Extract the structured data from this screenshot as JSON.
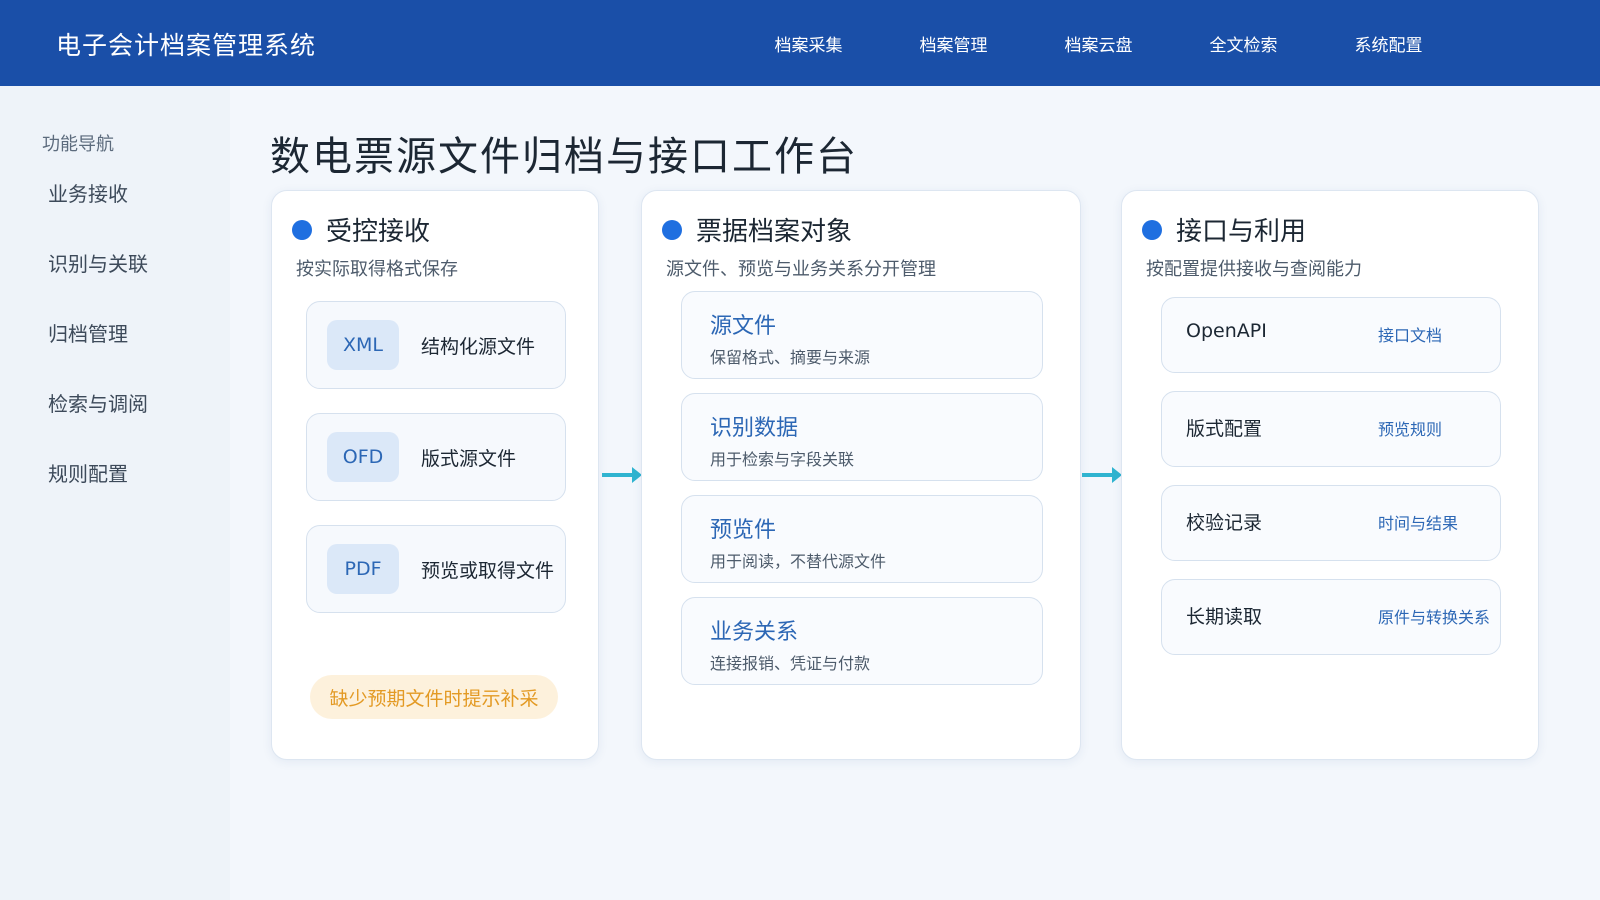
{
  "header": {
    "app_title": "电子会计档案管理系统",
    "nav": [
      "档案采集",
      "档案管理",
      "档案云盘",
      "全文检索",
      "系统配置"
    ]
  },
  "sidebar": {
    "title": "功能导航",
    "items": [
      "业务接收",
      "识别与关联",
      "归档管理",
      "检索与调阅",
      "规则配置"
    ]
  },
  "main": {
    "page_title": "数电票源文件归档与接口工作台",
    "intake": {
      "title": "受控接收",
      "subtitle": "按实际取得格式保存",
      "formats": [
        {
          "badge": "XML",
          "label": "结构化源文件"
        },
        {
          "badge": "OFD",
          "label": "版式源文件"
        },
        {
          "badge": "PDF",
          "label": "预览或取得文件"
        }
      ],
      "warning": "缺少预期文件时提示补采"
    },
    "objects": {
      "title": "票据档案对象",
      "subtitle": "源文件、预览与业务关系分开管理",
      "items": [
        {
          "title": "源文件",
          "desc": "保留格式、摘要与来源"
        },
        {
          "title": "识别数据",
          "desc": "用于检索与字段关联"
        },
        {
          "title": "预览件",
          "desc": "用于阅读，不替代源文件"
        },
        {
          "title": "业务关系",
          "desc": "连接报销、凭证与付款"
        }
      ]
    },
    "api": {
      "title": "接口与利用",
      "subtitle": "按配置提供接收与查阅能力",
      "items": [
        {
          "name": "OpenAPI",
          "link": "接口文档"
        },
        {
          "name": "版式配置",
          "link": "预览规则"
        },
        {
          "name": "校验记录",
          "link": "时间与结果"
        },
        {
          "name": "长期读取",
          "link": "原件与转换关系"
        }
      ]
    }
  },
  "colors": {
    "header_bg": "#1a4fa8",
    "accent": "#1f6fe0",
    "link": "#2c67b5",
    "arrow": "#2fb4d0",
    "warning_text": "#e39a24",
    "warning_bg": "#fdf1dc"
  }
}
